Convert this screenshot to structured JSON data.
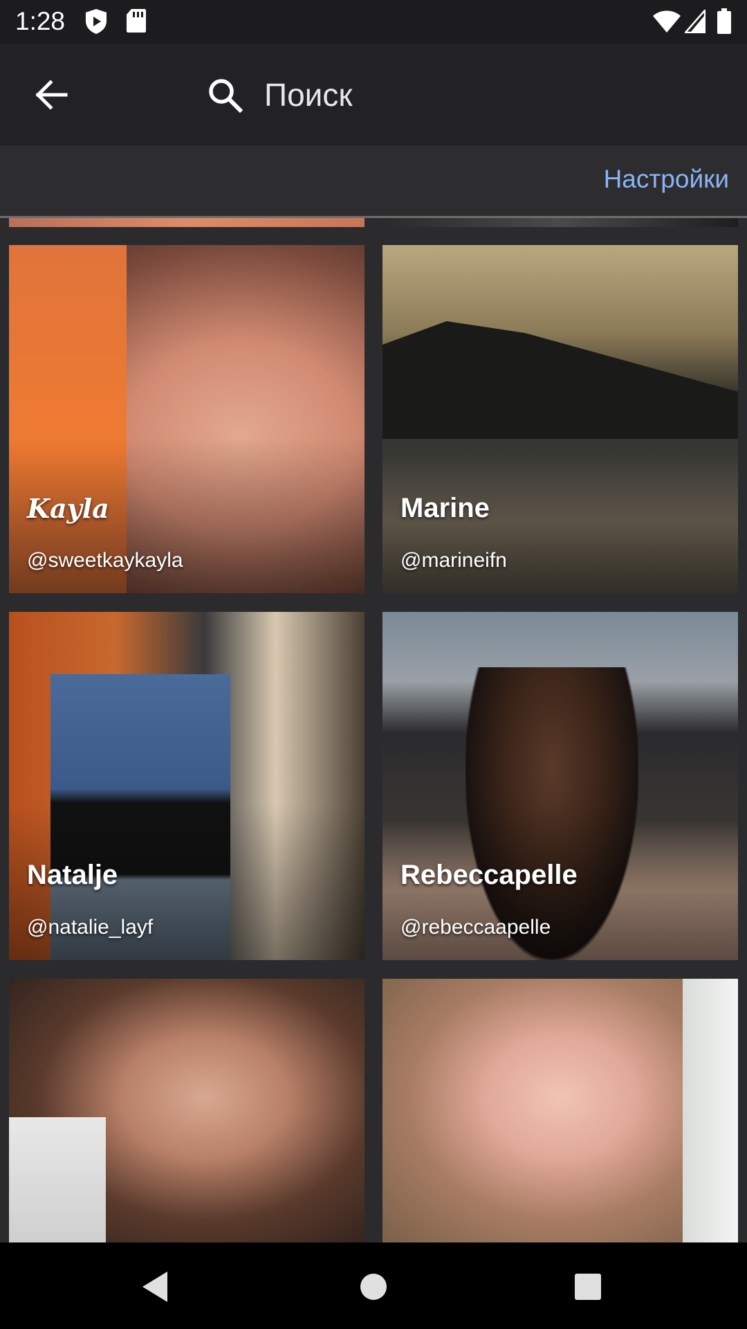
{
  "status_bar": {
    "time": "1:28",
    "icons": [
      "play-protect-icon",
      "sd-card-icon",
      "wifi-icon",
      "signal-icon",
      "battery-icon"
    ]
  },
  "app_bar": {
    "back_icon": "arrow-back-icon",
    "search_icon": "search-icon",
    "search_placeholder": "Поиск"
  },
  "settings_bar": {
    "settings_label": "Настройки",
    "accent_color": "#8ab4f8"
  },
  "profiles": [
    {
      "name": "Kayla",
      "handle": "@sweetkaykayla"
    },
    {
      "name": "Marine",
      "handle": "@marineifn"
    },
    {
      "name": "Natalje",
      "handle": "@natalie_layf"
    },
    {
      "name": "Rebeccapelle",
      "handle": "@rebeccaapelle"
    },
    {
      "name": "",
      "handle": ""
    },
    {
      "name": "",
      "handle": ""
    }
  ],
  "nav_bar": {
    "icons": [
      "back-triangle-icon",
      "home-circle-icon",
      "recents-square-icon"
    ]
  }
}
